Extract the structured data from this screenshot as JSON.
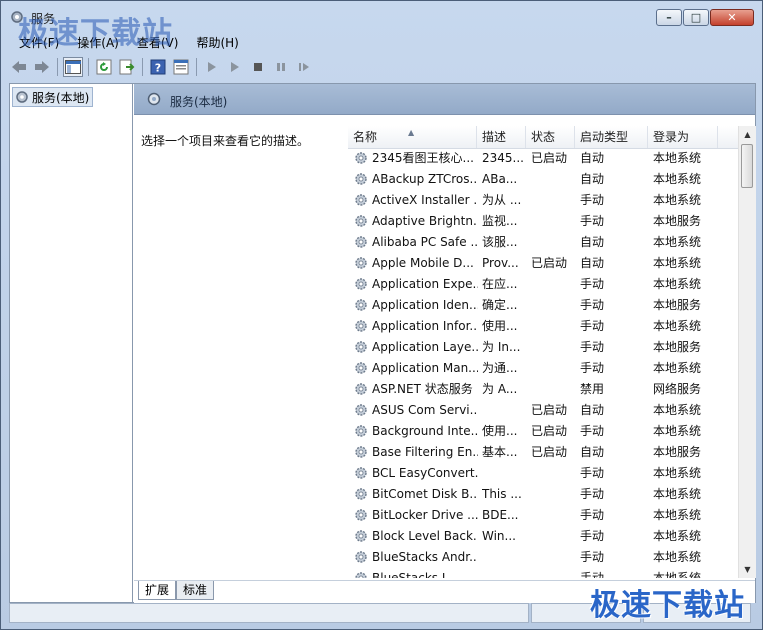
{
  "window": {
    "title": "服务",
    "min_glyph": "–",
    "max_glyph": "□",
    "close_glyph": "✕"
  },
  "menu": [
    "文件(F)",
    "操作(A)",
    "查看(V)",
    "帮助(H)"
  ],
  "toolbar_icons": [
    "back-arrow-icon",
    "forward-arrow-icon",
    "show-console-tree-icon",
    "refresh-icon",
    "export-list-icon",
    "help-icon",
    "properties-icon",
    "start-service-icon",
    "start-service-alt-icon",
    "stop-service-icon",
    "pause-service-icon",
    "resume-service-icon"
  ],
  "tree": {
    "root_label": "服务(本地)"
  },
  "panel": {
    "title": "服务(本地)",
    "description": "选择一个项目来查看它的描述。"
  },
  "columns": [
    "名称",
    "描述",
    "状态",
    "启动类型",
    "登录为"
  ],
  "rows": [
    [
      "2345看图王核心...",
      "2345...",
      "已启动",
      "自动",
      "本地系统"
    ],
    [
      "ABackup ZTCros...",
      "ABa...",
      "",
      "自动",
      "本地系统"
    ],
    [
      "ActiveX Installer ...",
      "为从 ...",
      "",
      "手动",
      "本地系统"
    ],
    [
      "Adaptive Brightn...",
      "监视...",
      "",
      "手动",
      "本地服务"
    ],
    [
      "Alibaba PC Safe ...",
      "该服...",
      "",
      "自动",
      "本地系统"
    ],
    [
      "Apple Mobile D...",
      "Prov...",
      "已启动",
      "自动",
      "本地系统"
    ],
    [
      "Application Expe...",
      "在应...",
      "",
      "手动",
      "本地系统"
    ],
    [
      "Application Iden...",
      "确定...",
      "",
      "手动",
      "本地服务"
    ],
    [
      "Application Infor...",
      "使用...",
      "",
      "手动",
      "本地系统"
    ],
    [
      "Application Laye...",
      "为 In...",
      "",
      "手动",
      "本地服务"
    ],
    [
      "Application Man...",
      "为通...",
      "",
      "手动",
      "本地系统"
    ],
    [
      "ASP.NET 状态服务",
      "为 A...",
      "",
      "禁用",
      "网络服务"
    ],
    [
      "ASUS Com Servi...",
      "",
      "已启动",
      "自动",
      "本地系统"
    ],
    [
      "Background Inte...",
      "使用...",
      "已启动",
      "手动",
      "本地系统"
    ],
    [
      "Base Filtering En...",
      "基本...",
      "已启动",
      "自动",
      "本地服务"
    ],
    [
      "BCL EasyConvert...",
      "",
      "",
      "手动",
      "本地系统"
    ],
    [
      "BitComet Disk B...",
      "This ...",
      "",
      "手动",
      "本地系统"
    ],
    [
      "BitLocker Drive ...",
      "BDE...",
      "",
      "手动",
      "本地系统"
    ],
    [
      "Block Level Back...",
      "Win...",
      "",
      "手动",
      "本地系统"
    ],
    [
      "BlueStacks Andr...",
      "",
      "",
      "手动",
      "本地系统"
    ],
    [
      "BlueStacks L...",
      "",
      "",
      "手动",
      "本地系统"
    ]
  ],
  "tabs": [
    "扩展",
    "标准"
  ],
  "watermark": "极速下载站"
}
